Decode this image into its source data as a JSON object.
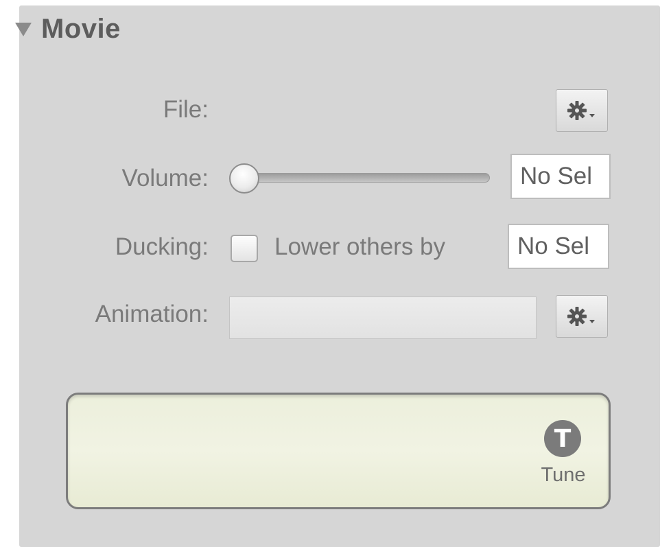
{
  "section": {
    "title": "Movie"
  },
  "fields": {
    "file_label": "File:",
    "volume_label": "Volume:",
    "volume_value": "No Sel",
    "ducking_label": "Ducking:",
    "ducking_checkbox_label": "Lower others by",
    "ducking_value": "No Sel",
    "animation_label": "Animation:"
  },
  "volume_slider": {
    "level": 0.0
  },
  "ducking_checked": false,
  "tune": {
    "icon_glyph": "T",
    "label": "Tune"
  },
  "icons": {
    "disclosure": "disclosure-triangle-icon",
    "gear": "gear-icon",
    "tune": "tune-icon"
  },
  "colors": {
    "panel_bg": "#d6d6d6",
    "tune_bg": "#eef0dd"
  }
}
